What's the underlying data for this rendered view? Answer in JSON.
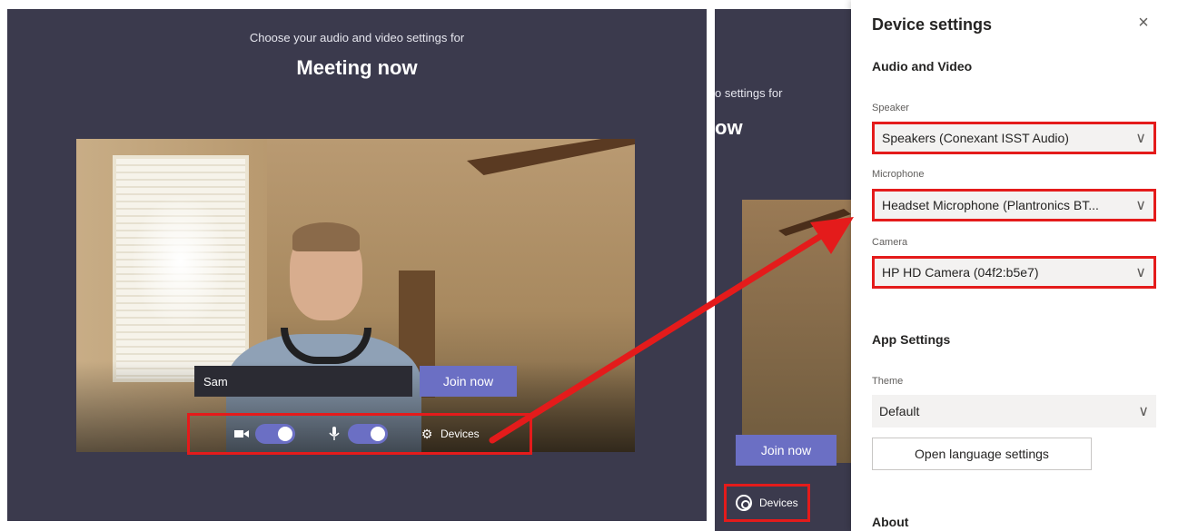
{
  "prejoin": {
    "subtitle": "Choose your audio and video settings for",
    "title": "Meeting now",
    "name_value": "Sam",
    "join_label": "Join now",
    "devices_label": "Devices"
  },
  "behind": {
    "subtitle_fragment": "o settings for",
    "title_fragment": "ow",
    "join_label": "Join now",
    "devices_label": "Devices"
  },
  "settings": {
    "title": "Device settings",
    "audio_video_heading": "Audio and Video",
    "speaker_label": "Speaker",
    "speaker_value": "Speakers (Conexant ISST Audio)",
    "microphone_label": "Microphone",
    "microphone_value": "Headset Microphone (Plantronics BT...",
    "camera_label": "Camera",
    "camera_value": "HP HD Camera (04f2:b5e7)",
    "app_settings_heading": "App Settings",
    "theme_label": "Theme",
    "theme_value": "Default",
    "language_button": "Open language settings",
    "about_heading": "About"
  },
  "icons": {
    "close": "×",
    "chevron": "∨",
    "camera": "■◂",
    "mic": "🎙",
    "gear": "⚙"
  },
  "colors": {
    "accent": "#6b6fc4",
    "highlight_red": "#e41b1b",
    "dark_bg": "#3b3a4d"
  }
}
